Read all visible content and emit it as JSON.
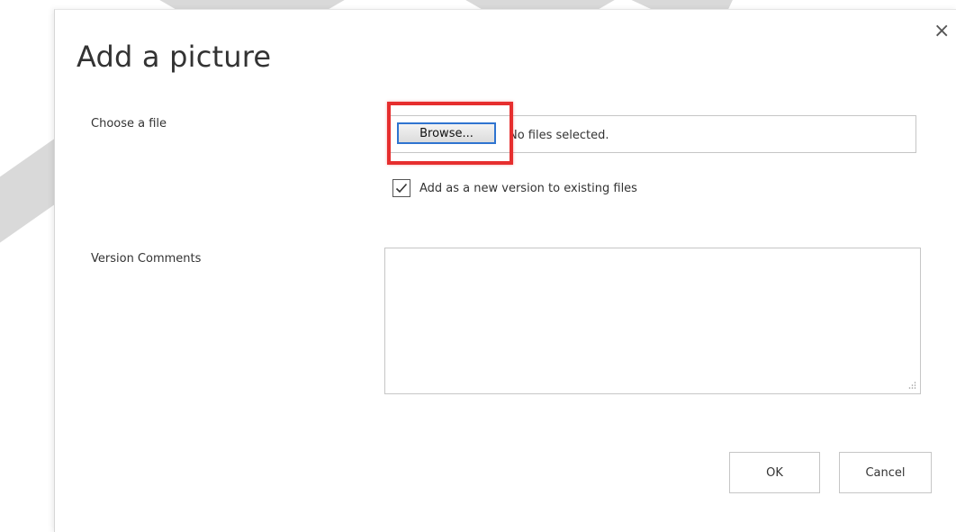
{
  "dialog": {
    "title": "Add a picture",
    "close_glyph": "×",
    "choose_file_label": "Choose a file",
    "browse_label": "Browse...",
    "file_status": "No files selected.",
    "add_version_checked": true,
    "add_version_label": "Add as a new version to existing files",
    "version_comments_label": "Version Comments",
    "version_comments_value": "",
    "ok_label": "OK",
    "cancel_label": "Cancel"
  },
  "colors": {
    "highlight": "#e62e2e",
    "focus_border": "#2f74d0"
  },
  "icons": {
    "close": "close-icon",
    "checkmark": "checkmark-icon",
    "resize": "resize-grip-icon"
  }
}
